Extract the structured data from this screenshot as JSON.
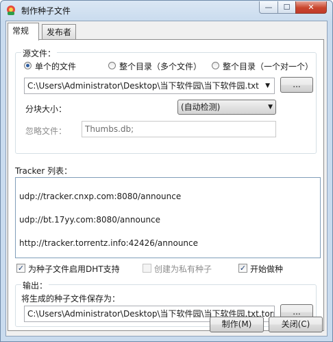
{
  "window": {
    "title": "制作种子文件",
    "minimize_glyph": "—",
    "maximize_glyph": "☐",
    "close_glyph": "✕"
  },
  "tabs": [
    {
      "label": "常规",
      "active": true
    },
    {
      "label": "发布者",
      "active": false
    }
  ],
  "source": {
    "group_label": "源文件：",
    "modes": [
      "单个的文件",
      "整个目录（多个文件）",
      "整个目录（一个对一个）"
    ],
    "selected_mode": "单个的文件",
    "path_value": "C:\\Users\\Administrator\\Desktop\\当下软件园\\当下软件园.txt",
    "browse_label": "...",
    "piece_size_label": "分块大小：",
    "piece_size_value": "(自动检测)",
    "ignore_label": "忽略文件：",
    "ignore_value": "Thumbs.db;"
  },
  "tracker": {
    "label": "Tracker 列表：",
    "items": [
      "udp://tracker.cnxp.com:8080/announce",
      "udp://bt.17yy.com:8080/announce",
      "http://tracker.torrentz.info:42426/announce"
    ]
  },
  "options": {
    "dht_label": "为种子文件启用DHT支持",
    "dht_checked": true,
    "private_label": "创建为私有种子",
    "private_checked": false,
    "start_label": "开始做种",
    "start_checked": true
  },
  "output": {
    "group_label": "输出：",
    "save_as_label": "将生成的种子文件保存为：",
    "path_value": "C:\\Users\\Administrator\\Desktop\\当下软件园\\当下软件园.txt.torr",
    "browse_label": "..."
  },
  "footer": {
    "make_label": "制作(M)",
    "close_label": "关闭(C)"
  },
  "colors": {
    "accent": "#2e5fa3",
    "close_button": "#c0392b",
    "frame": "#c9dbee"
  },
  "icons": {
    "app": "app-icon",
    "dropdown": "chevron-down-icon",
    "check": "checkmark-icon"
  }
}
